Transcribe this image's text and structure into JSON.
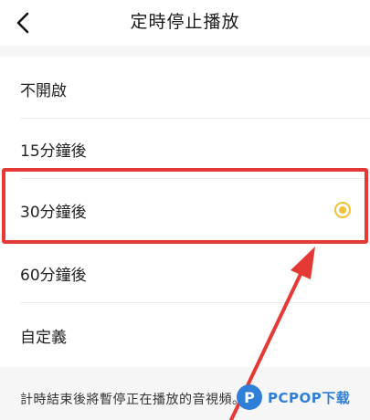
{
  "header": {
    "title": "定時停止播放"
  },
  "options": [
    {
      "label": "不開啟"
    },
    {
      "label": "15分鐘後"
    },
    {
      "label": "30分鐘後",
      "selected": true
    },
    {
      "label": "60分鐘後"
    },
    {
      "label": "自定義"
    }
  ],
  "footer": {
    "note": "計時結束後將暫停正在播放的音視頻。"
  },
  "watermark": {
    "logo_letter": "P",
    "text": "PCPOP下载"
  },
  "colors": {
    "accent": "#f0c23a",
    "highlight": "#e53935",
    "watermark": "#2f7fd8"
  },
  "icons": {
    "back": "chevron-left-icon",
    "radio": "radio-selected-icon"
  }
}
